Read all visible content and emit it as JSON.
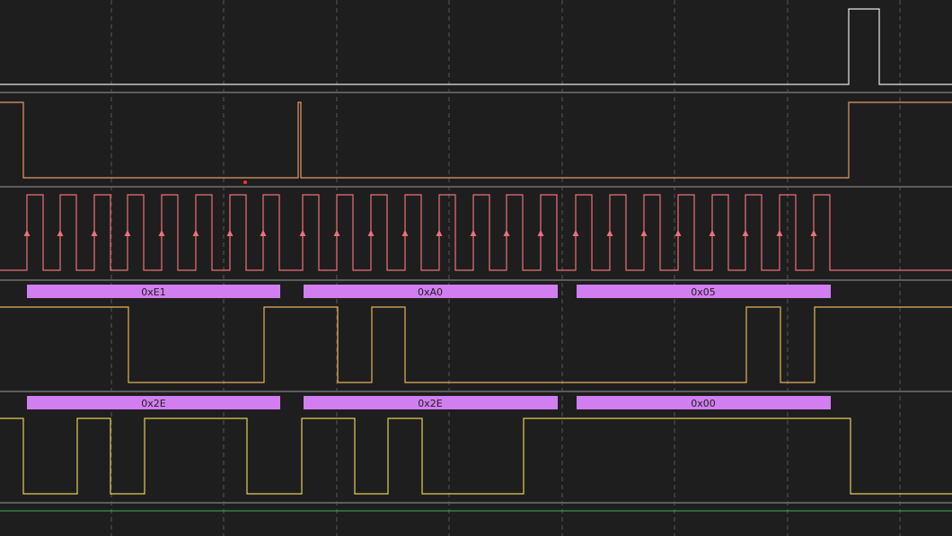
{
  "colors": {
    "background": "#1e1e1e",
    "grid": "#555555",
    "divider": "#5c5c5c",
    "channel_0": "#e8e8e8",
    "channel_1": "#e39a67",
    "channel_2": "#ef6f7a",
    "channel_3": "#e6b25b",
    "channel_4": "#e3cf55",
    "decode_box": "#d27ef0",
    "bottom_line": "#3fae5a",
    "marker": "#ff3333"
  },
  "decode_mosi": {
    "bytes": [
      "0xE1",
      "0xA0",
      "0x05"
    ]
  },
  "decode_miso": {
    "bytes": [
      "0x2E",
      "0x2E",
      "0x00"
    ]
  }
}
